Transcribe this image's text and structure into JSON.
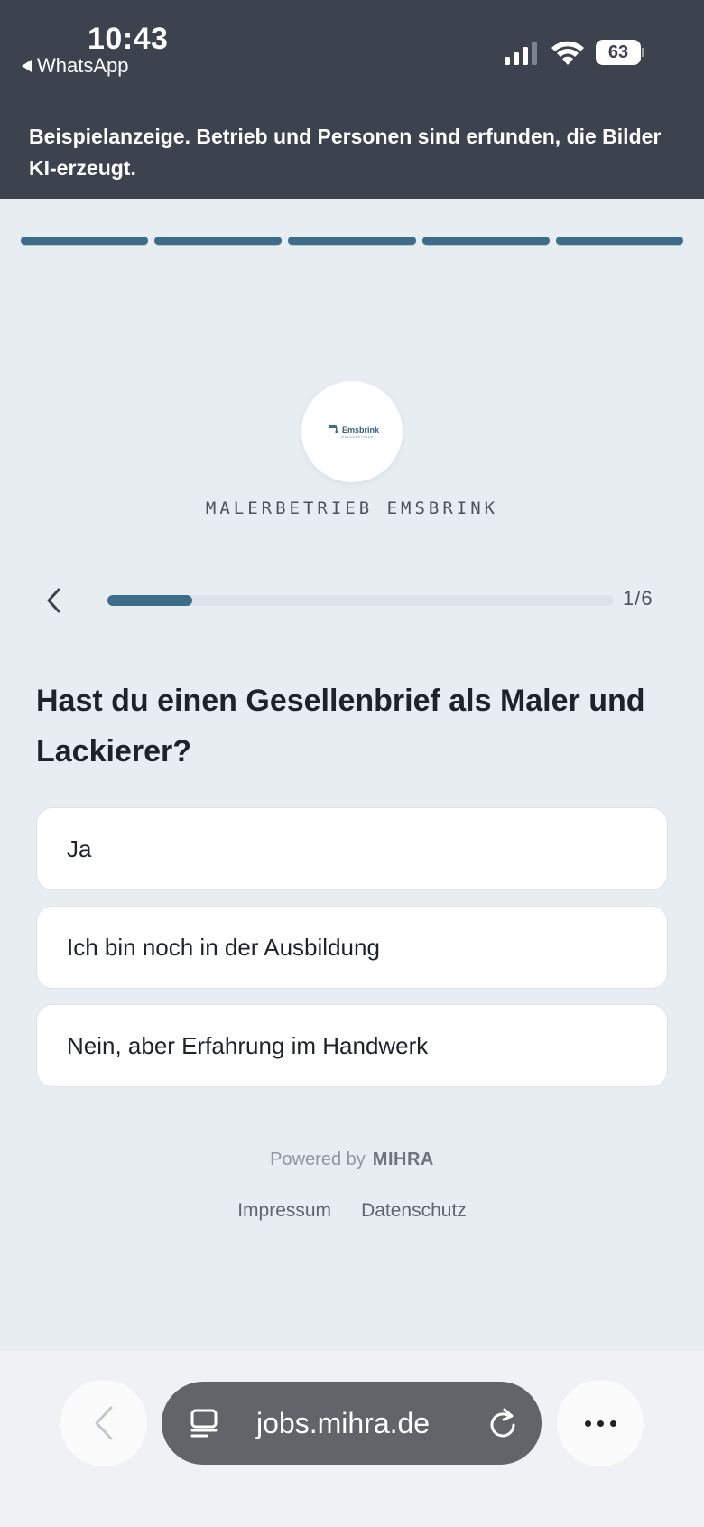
{
  "status_bar": {
    "time": "10:43",
    "back_app": "WhatsApp",
    "battery": "63"
  },
  "disclaimer": "Beispielanzeige. Betrieb und Personen sind erfunden, die Bilder KI-erzeugt.",
  "step_indicator": {
    "total": 5,
    "completed": 5,
    "color": "#3d6e89"
  },
  "logo": {
    "name": "Emsbrink",
    "subtitle": "MALERBETRIEB"
  },
  "company_name": "MALERBETRIEB EMSBRINK",
  "question_progress": {
    "current": 1,
    "total": 6,
    "label": "1/6"
  },
  "question": "Hast du einen Gesellenbrief als Maler und Lackierer?",
  "answers": [
    {
      "label": "Ja"
    },
    {
      "label": "Ich bin noch in der Ausbildung"
    },
    {
      "label": "Nein, aber Erfahrung im Handwerk"
    }
  ],
  "footer": {
    "powered_by": "Powered by",
    "brand": "MIHRA",
    "impressum": "Impressum",
    "datenschutz": "Datenschutz"
  },
  "browser": {
    "url": "jobs.mihra.de",
    "icons": [
      "chevron-left-icon",
      "reader-icon",
      "reload-icon",
      "more-icon"
    ]
  },
  "colors": {
    "header_bg": "#3c424e",
    "page_bg": "#e8edf1",
    "accent": "#3d6e89"
  }
}
